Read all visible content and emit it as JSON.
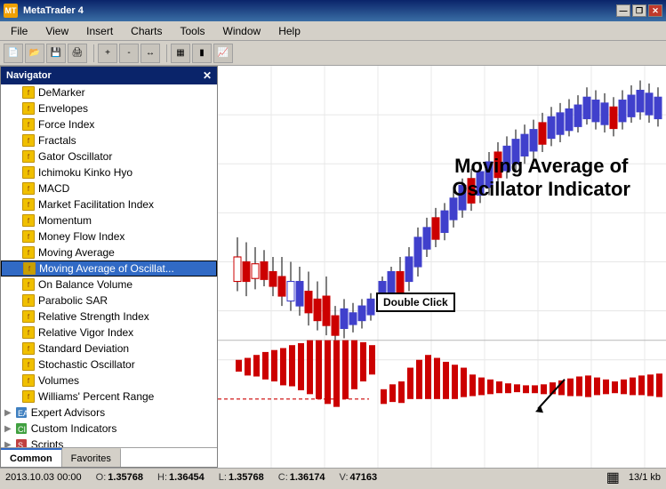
{
  "window": {
    "title": "MetaTrader 4",
    "title_icon": "MT"
  },
  "menu": {
    "items": [
      "File",
      "View",
      "Insert",
      "Charts",
      "Tools",
      "Window",
      "Help"
    ]
  },
  "navigator": {
    "title": "Navigator",
    "indicators": [
      "DeMarker",
      "Envelopes",
      "Force Index",
      "Fractals",
      "Gator Oscillator",
      "Ichimoku Kinko Hyo",
      "MACD",
      "Market Facilitation Index",
      "Momentum",
      "Money Flow Index",
      "Moving Average",
      "Moving Average of Oscillat...",
      "On Balance Volume",
      "Parabolic SAR",
      "Relative Strength Index",
      "Relative Vigor Index",
      "Standard Deviation",
      "Stochastic Oscillator",
      "Volumes",
      "Williams' Percent Range"
    ],
    "sections": [
      "Expert Advisors",
      "Custom Indicators",
      "Scripts"
    ],
    "tabs": [
      "Common",
      "Favorites"
    ]
  },
  "chart": {
    "annotation_line1": "Moving Average of",
    "annotation_line2": "Oscillator Indicator",
    "double_click_label": "Double Click"
  },
  "status_bar": {
    "date": "2013.10.03 00:00",
    "open_label": "O:",
    "open_val": "1.35768",
    "high_label": "H:",
    "high_val": "1.36454",
    "low_label": "L:",
    "low_val": "1.35768",
    "close_label": "C:",
    "close_val": "1.36174",
    "volume_label": "V:",
    "volume_val": "47163",
    "info": "13/1 kb"
  },
  "title_bar_buttons": {
    "minimize": "—",
    "restore": "❐",
    "close": "✕"
  },
  "inner_title_bar_buttons": {
    "minimize": "—",
    "restore": "❐",
    "close": "✕"
  }
}
